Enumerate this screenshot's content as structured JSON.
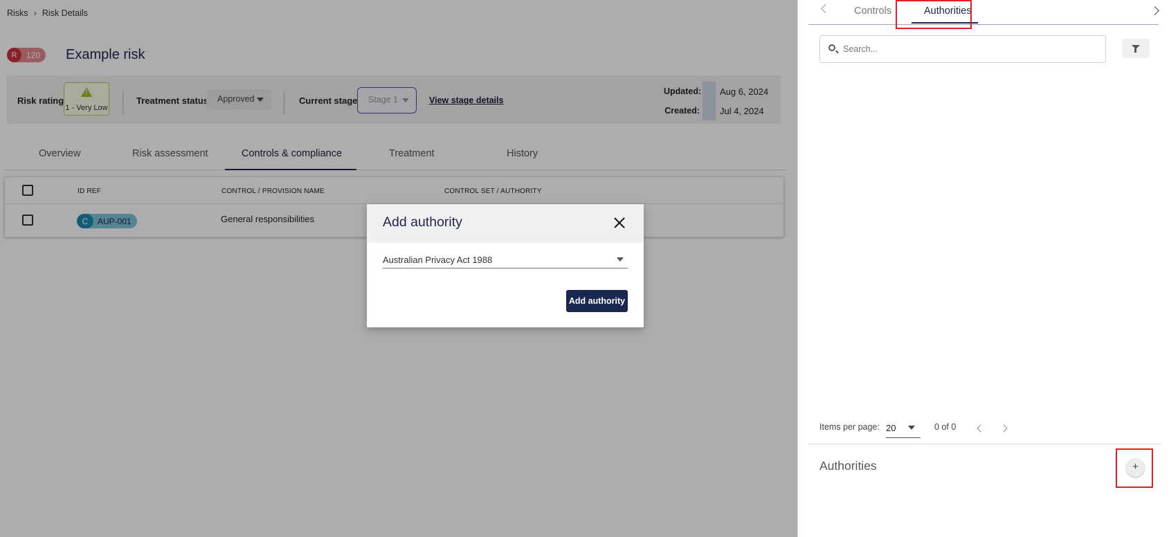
{
  "breadcrumb": {
    "root": "Risks",
    "current": "Risk Details"
  },
  "risk": {
    "badge_letter": "R",
    "badge_number": "120",
    "title": "Example risk"
  },
  "summary": {
    "rating_label": "Risk rating:",
    "rating_value": "1 - Very Low",
    "treatment_label": "Treatment status:",
    "treatment_value": "Approved",
    "stage_label": "Current stage:",
    "stage_value": "Stage 1",
    "stage_link": "View stage details",
    "updated_label": "Updated:",
    "updated_value": "Aug 6, 2024",
    "created_label": "Created:",
    "created_value": "Jul 4, 2024"
  },
  "tabs": [
    "Overview",
    "Risk assessment",
    "Controls & compliance",
    "Treatment",
    "History"
  ],
  "active_tab": "Controls & compliance",
  "table": {
    "columns": [
      "ID REF",
      "CONTROL / PROVISION NAME",
      "CONTROL SET / AUTHORITY"
    ],
    "rows": [
      {
        "type_letter": "C",
        "id_ref": "AUP-001",
        "name": "General responsibilities",
        "authority": ""
      }
    ]
  },
  "side_panel": {
    "tabs": [
      "Controls",
      "Authorities"
    ],
    "active_tab": "Authorities",
    "search_placeholder": "Search...",
    "items_per_page_label": "Items per page:",
    "items_per_page_value": "20",
    "range_text": "0 of 0",
    "section_title": "Authorities",
    "add_symbol": "+"
  },
  "modal": {
    "title": "Add authority",
    "selected_authority": "Australian Privacy Act 1988",
    "submit_label": "Add authority"
  },
  "colors": {
    "brand_navy": "#1a2751",
    "risk_red": "#c8333a",
    "control_teal": "#1c89b3",
    "rating_green": "#9bbf1e",
    "highlight_red": "#e02020"
  }
}
